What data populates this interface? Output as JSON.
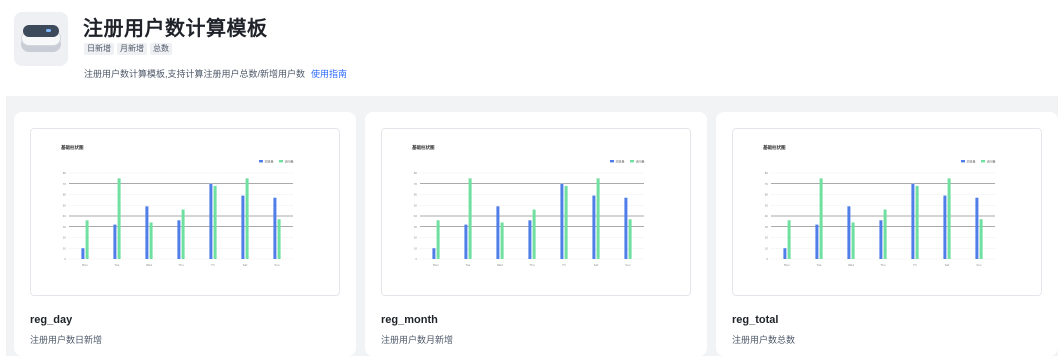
{
  "template": {
    "title": "注册用户数计算模板",
    "tags": [
      "日新增",
      "月新增",
      "总数"
    ],
    "description": "注册用户数计算模板,支持计算注册用户总数/新增用户数",
    "guide_link": "使用指南"
  },
  "cards": [
    {
      "name": "reg_day",
      "subtitle": "注册用户数日新增"
    },
    {
      "name": "reg_month",
      "subtitle": "注册用户数月新增"
    },
    {
      "name": "reg_total",
      "subtitle": "注册用户数总数"
    }
  ],
  "colors": {
    "series_a": "#4f7ee8",
    "series_b": "#6fe0a0",
    "accent": "#2f6bff"
  },
  "icons": {
    "app": "database-disk-icon"
  },
  "chart_data": {
    "type": "bar",
    "title": "基础柱状图",
    "categories": [
      "Mon",
      "Tue",
      "Wed",
      "Thu",
      "Fri",
      "Sat",
      "Sun"
    ],
    "series": [
      {
        "name": "浏览量",
        "values": [
          10,
          32,
          49,
          36,
          70,
          59,
          57
        ]
      },
      {
        "name": "访问量",
        "values": [
          36,
          75,
          34,
          46,
          68,
          75,
          37
        ]
      }
    ],
    "ylim": [
      0,
      80
    ],
    "yticks": [
      0,
      10,
      20,
      30,
      40,
      50,
      60,
      70,
      80
    ],
    "legend": "top-right",
    "grid": true
  }
}
